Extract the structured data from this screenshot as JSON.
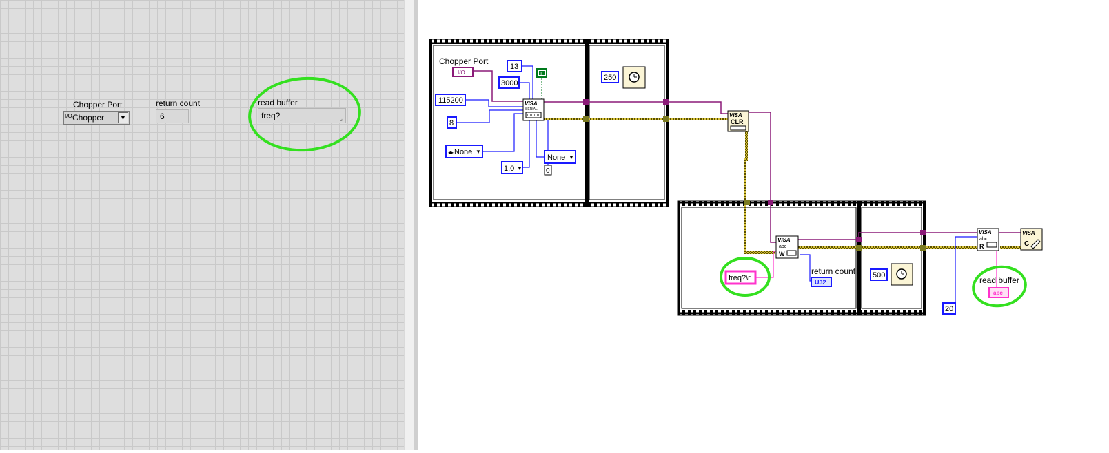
{
  "front_panel": {
    "chopper_port_label": "Chopper Port",
    "chopper_port_value": "Chopper",
    "chopper_port_prefix": "I/O",
    "return_count_label": "return count",
    "return_count_value": "6",
    "read_buffer_label": "read buffer",
    "read_buffer_value": "freq?"
  },
  "block_diagram": {
    "chopper_port_label": "Chopper Port",
    "io_terminal": "I/O",
    "const_13": "13",
    "const_true": "T",
    "const_3000": "3000",
    "const_115200": "115200",
    "const_8": "8",
    "parity_value": "None",
    "stop_bits_value": "1.0",
    "flow_value": "None",
    "const_0": "0",
    "wait_250": "250",
    "visa_label": "VISA",
    "serial_label": "SERIAL",
    "clr_label": "CLR",
    "write_string": "freq?\\r",
    "return_count_label": "return count",
    "u32_label": "U32",
    "wait_500": "500",
    "const_20": "20",
    "read_buffer_label": "read buffer",
    "abc_label": "abc",
    "write_letter": "W",
    "read_letter": "R",
    "close_letter": "C"
  },
  "colors": {
    "numeric_blue": "#1a1aff",
    "string_pink": "#ff33cc",
    "refnum_purple": "#8b1a78",
    "error_cluster": "#b5a000",
    "highlight_green": "#34e020",
    "boolean_green": "#007a1c"
  }
}
